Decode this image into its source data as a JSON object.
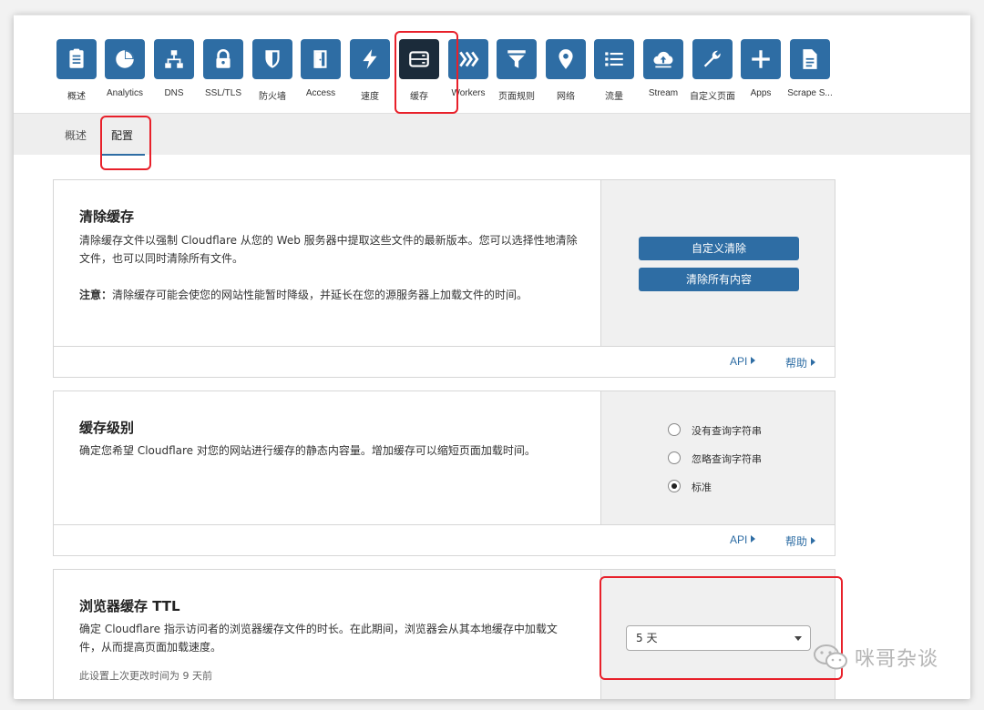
{
  "nav": {
    "items": [
      {
        "label": "概述",
        "icon": "clipboard-icon"
      },
      {
        "label": "Analytics",
        "icon": "pie-chart-icon"
      },
      {
        "label": "DNS",
        "icon": "network-icon"
      },
      {
        "label": "SSL/TLS",
        "icon": "lock-icon"
      },
      {
        "label": "防火墙",
        "icon": "shield-icon"
      },
      {
        "label": "Access",
        "icon": "door-icon"
      },
      {
        "label": "速度",
        "icon": "lightning-icon"
      },
      {
        "label": "缓存",
        "icon": "server-icon"
      },
      {
        "label": "Workers",
        "icon": "chevrons-icon"
      },
      {
        "label": "页面规则",
        "icon": "filter-icon"
      },
      {
        "label": "网络",
        "icon": "location-pin-icon"
      },
      {
        "label": "流量",
        "icon": "list-icon"
      },
      {
        "label": "Stream",
        "icon": "cloud-upload-icon"
      },
      {
        "label": "自定义页面",
        "icon": "wrench-icon"
      },
      {
        "label": "Apps",
        "icon": "plus-icon"
      },
      {
        "label": "Scrape S...",
        "icon": "document-icon"
      }
    ],
    "active_index": 7
  },
  "subtabs": {
    "overview": "概述",
    "config": "配置"
  },
  "purge_card": {
    "title": "清除缓存",
    "description": "清除缓存文件以强制 Cloudflare 从您的 Web 服务器中提取这些文件的最新版本。您可以选择性地清除文件，也可以同时清除所有文件。",
    "note_label": "注意：",
    "note_text": "清除缓存可能会使您的网站性能暂时降级，并延长在您的源服务器上加载文件的时间。",
    "custom_purge_button": "自定义清除",
    "purge_all_button": "清除所有内容",
    "api_link": "API",
    "help_link": "帮助"
  },
  "cache_level_card": {
    "title": "缓存级别",
    "description": "确定您希望 Cloudflare 对您的网站进行缓存的静态内容量。增加缓存可以缩短页面加载时间。",
    "options": [
      {
        "label": "没有查询字符串",
        "checked": false
      },
      {
        "label": "忽略查询字符串",
        "checked": false
      },
      {
        "label": "标准",
        "checked": true
      }
    ],
    "api_link": "API",
    "help_link": "帮助"
  },
  "browser_ttl_card": {
    "title": "浏览器缓存 TTL",
    "description": "确定 Cloudflare 指示访问者的浏览器缓存文件的时长。在此期间，浏览器会从其本地缓存中加载文件，从而提高页面加载速度。",
    "last_changed": "此设置上次更改时间为 9 天前",
    "selected_value": "5 天"
  },
  "watermark": {
    "text": "咪哥杂谈",
    "icon": "wechat-icon"
  },
  "colors": {
    "brand_blue": "#2e6da4",
    "active_tile": "#1b2b3a",
    "highlight_red": "#e8202a"
  }
}
